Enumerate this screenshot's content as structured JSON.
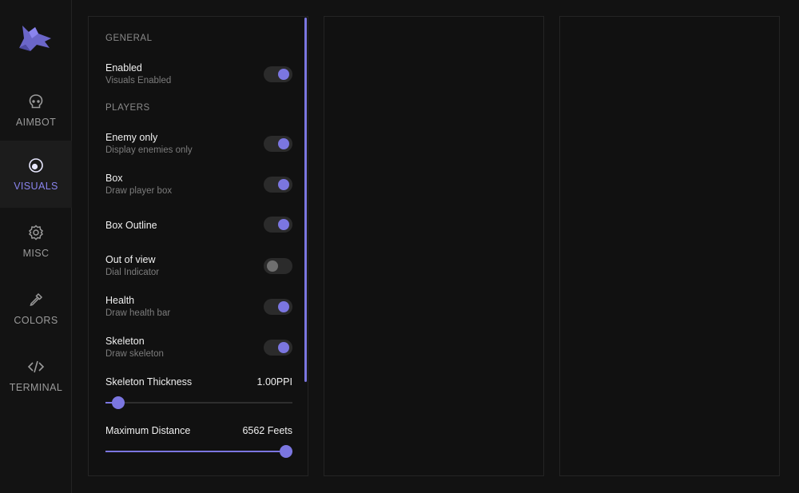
{
  "sidebar": {
    "items": [
      {
        "label": "AIMBOT",
        "icon": "skull-icon"
      },
      {
        "label": "VISUALS",
        "icon": "eye-icon",
        "active": true
      },
      {
        "label": "MISC",
        "icon": "gear-icon"
      },
      {
        "label": "COLORS",
        "icon": "eyedropper-icon"
      },
      {
        "label": "TERMINAL",
        "icon": "code-icon"
      }
    ]
  },
  "visuals": {
    "general_header": "GENERAL",
    "players_header": "PLAYERS",
    "settings": [
      {
        "title": "Enabled",
        "desc": "Visuals Enabled",
        "on": true
      },
      {
        "title": "Enemy only",
        "desc": "Display enemies only",
        "on": true
      },
      {
        "title": "Box",
        "desc": "Draw player box",
        "on": true
      },
      {
        "title": "Box Outline",
        "desc": "",
        "on": true
      },
      {
        "title": "Out of view",
        "desc": "Dial Indicator",
        "on": false
      },
      {
        "title": "Health",
        "desc": "Draw health bar",
        "on": true
      },
      {
        "title": "Skeleton",
        "desc": "Draw skeleton",
        "on": true
      }
    ],
    "sliders": [
      {
        "label": "Skeleton Thickness",
        "value": "1.00PPI",
        "fraction": 0.07
      },
      {
        "label": "Maximum Distance",
        "value": "6562 Feets",
        "fraction": 1.0
      }
    ]
  },
  "colors": {
    "accent": "#7b76e0",
    "background": "#121212"
  }
}
